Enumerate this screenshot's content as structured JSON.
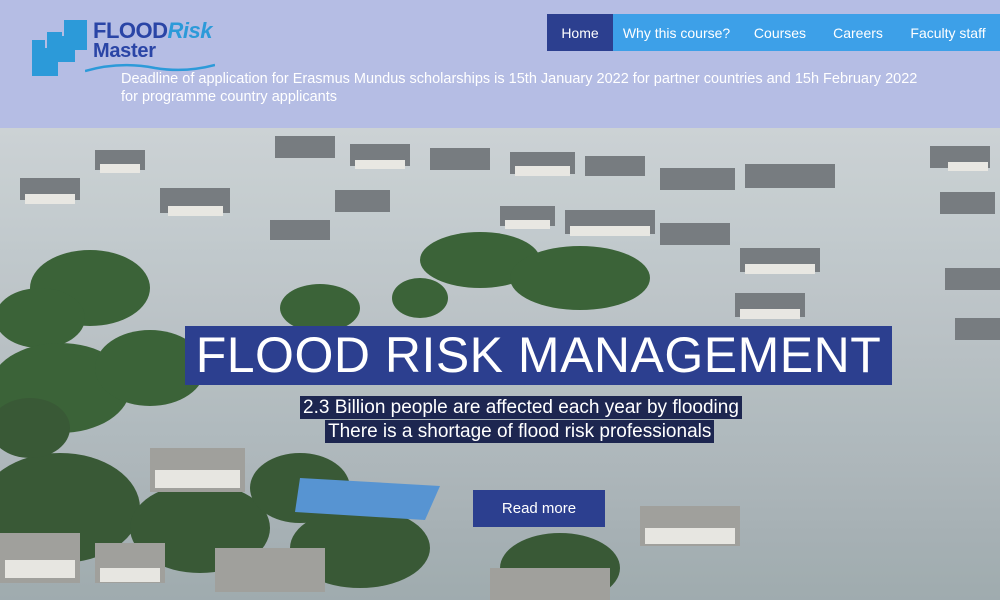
{
  "brand": {
    "name_part1": "FLOOD",
    "name_part2": "Risk",
    "name_part3": "Master",
    "color_primary": "#2a45a6",
    "color_accent": "#2c9ad9"
  },
  "nav": {
    "items": [
      {
        "label": "Home",
        "active": true
      },
      {
        "label": "Why this course?",
        "active": false
      },
      {
        "label": "Courses",
        "active": false
      },
      {
        "label": "Careers",
        "active": false
      },
      {
        "label": "Faculty staff",
        "active": false
      }
    ],
    "bar_color": "#3da0e8",
    "active_color": "#2c3f8f"
  },
  "notice": {
    "text": "Deadline of application for Erasmus Mundus scholarships is 15th January 2022 for partner countries and 15h February 2022 for programme country applicants"
  },
  "hero": {
    "title": "FLOOD RISK MANAGEMENT",
    "line1": "2.3 Billion people are affected each year by flooding",
    "line2": "There is a shortage of flood risk professionals",
    "button_label": "Read more",
    "image_subject": "aerial-flooded-neighborhood",
    "banner_color": "#2c3f8f"
  }
}
